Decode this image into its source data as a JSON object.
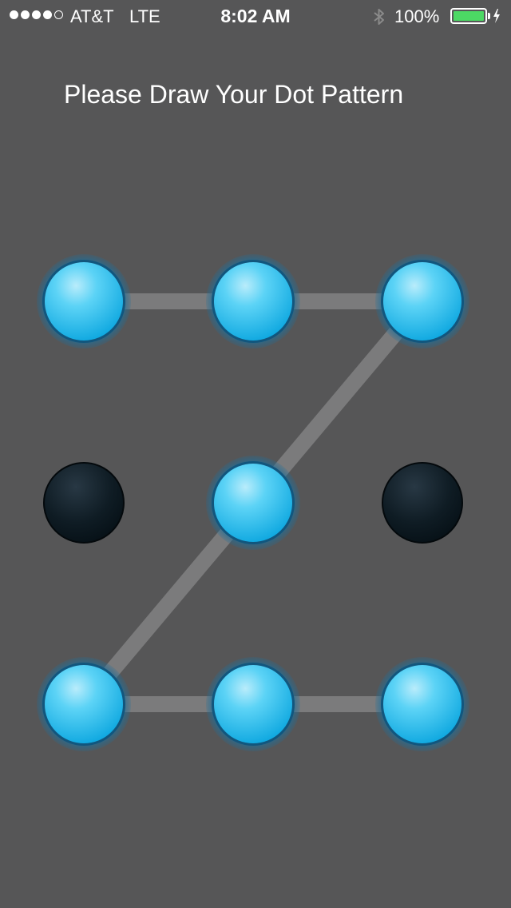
{
  "status_bar": {
    "signal_strength": 4,
    "signal_max": 5,
    "carrier": "AT&T",
    "network": "LTE",
    "time": "8:02 AM",
    "bluetooth_icon": "bluetooth-icon",
    "battery_percent": "100%",
    "battery_level": 1.0,
    "charging_icon": "charging-bolt-icon",
    "battery_color": "#4cd964"
  },
  "title": "Please Draw Your Dot Pattern",
  "pattern": {
    "grid_rows": 3,
    "grid_cols": 3,
    "dots": [
      {
        "row": 0,
        "col": 0,
        "selected": true
      },
      {
        "row": 0,
        "col": 1,
        "selected": true
      },
      {
        "row": 0,
        "col": 2,
        "selected": true
      },
      {
        "row": 1,
        "col": 0,
        "selected": false
      },
      {
        "row": 1,
        "col": 1,
        "selected": true
      },
      {
        "row": 1,
        "col": 2,
        "selected": false
      },
      {
        "row": 2,
        "col": 0,
        "selected": true
      },
      {
        "row": 2,
        "col": 1,
        "selected": true
      },
      {
        "row": 2,
        "col": 2,
        "selected": true
      }
    ],
    "path_order": [
      0,
      1,
      2,
      4,
      6,
      7,
      8
    ],
    "colors": {
      "background": "#565657",
      "selected_dot": "#23c1f0",
      "unselected_dot": "#0d1a22",
      "path_line": "#7b7b7c"
    }
  }
}
